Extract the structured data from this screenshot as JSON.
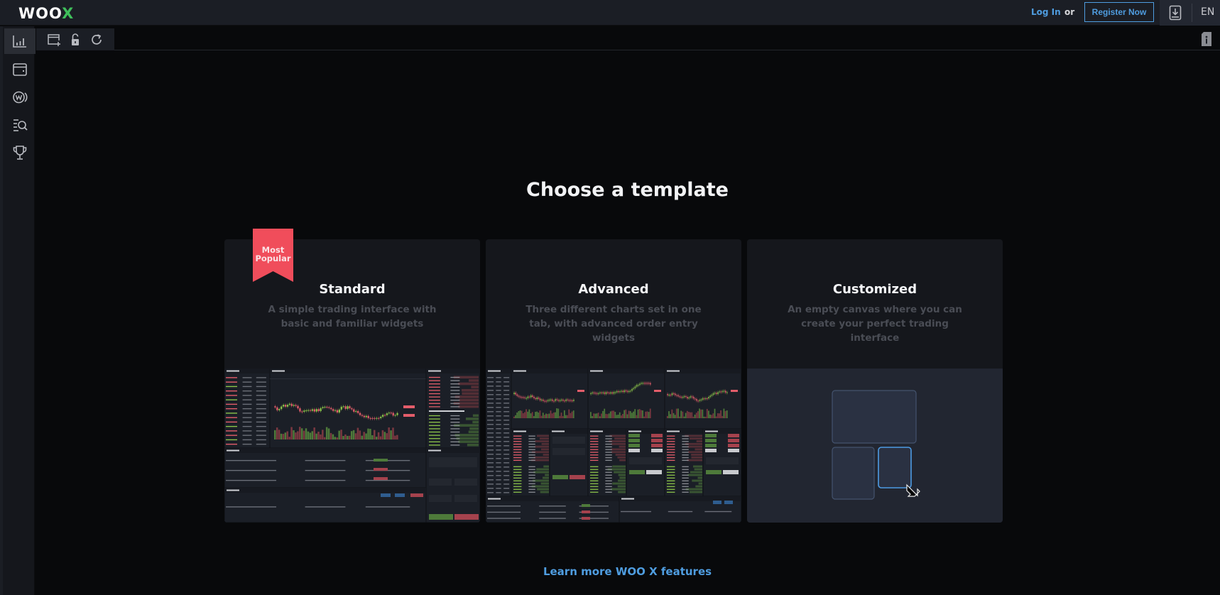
{
  "header": {
    "logo_text": "WOO",
    "logo_accent": "X",
    "login_label": "Log In",
    "or_label": "or",
    "register_label": "Register Now",
    "language": "EN"
  },
  "sidebar": {
    "items": [
      {
        "id": "charts",
        "icon": "bar-chart-icon",
        "active": true
      },
      {
        "id": "wallet",
        "icon": "wallet-icon",
        "active": false
      },
      {
        "id": "woo-earn",
        "icon": "woo-coin-icon",
        "active": false
      },
      {
        "id": "markets",
        "icon": "list-search-icon",
        "active": false
      },
      {
        "id": "rewards",
        "icon": "trophy-icon",
        "active": false
      }
    ]
  },
  "toolbar": {
    "buttons": [
      {
        "id": "add-window",
        "icon": "add-window-icon"
      },
      {
        "id": "lock",
        "icon": "unlock-icon"
      },
      {
        "id": "reset",
        "icon": "refresh-icon"
      }
    ],
    "right_icon": "info-book-icon"
  },
  "main": {
    "title": "Choose a template",
    "templates": [
      {
        "name": "Standard",
        "description": "A simple trading interface with basic and familiar widgets",
        "badge_line1": "Most",
        "badge_line2": "Popular"
      },
      {
        "name": "Advanced",
        "description": "Three different charts set in one tab, with advanced order entry widgets"
      },
      {
        "name": "Customized",
        "description": "An empty canvas where you can create your perfect trading interface"
      }
    ],
    "learn_more": "Learn more WOO X features"
  },
  "colors": {
    "accent_blue": "#4f9de0",
    "brand_green": "#3fbf5b",
    "badge_red": "#f04d5b",
    "background": "#08090b",
    "card_bg": "#15171c"
  }
}
